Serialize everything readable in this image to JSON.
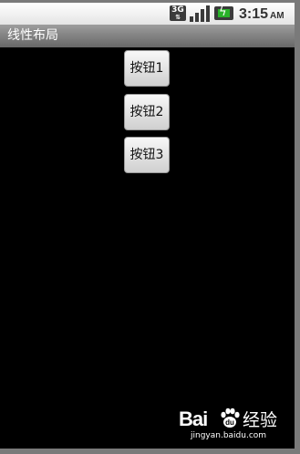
{
  "status_bar": {
    "network_label": "3G",
    "network_icon": "3g-data-icon",
    "signal_icon": "signal-strength-icon",
    "battery_icon": "battery-charging-icon",
    "time": "3:15",
    "am_pm": "AM"
  },
  "title_bar": {
    "title": "线性布局"
  },
  "buttons": [
    {
      "label": "按钮1"
    },
    {
      "label": "按钮2"
    },
    {
      "label": "按钮3"
    }
  ],
  "watermark": {
    "logo_text": "Bai",
    "logo_icon": "baidu-paw-icon",
    "product_text": "经验",
    "url": "jingyan.baidu.com"
  },
  "colors": {
    "background": "#000000",
    "status_bar": "#f0f0f0",
    "title_bar": "#8a8a8a",
    "battery_level": "#29b229"
  }
}
